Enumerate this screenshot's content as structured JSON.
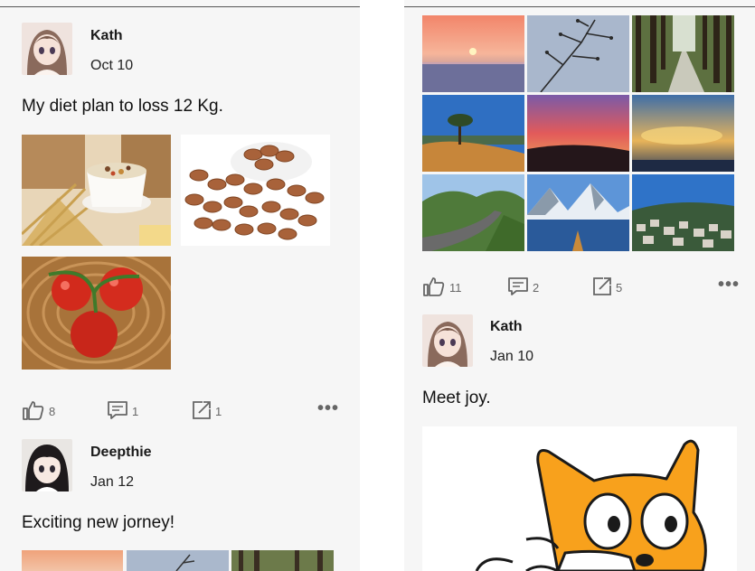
{
  "left_screen": {
    "post1": {
      "author": "Kath",
      "date": "Oct 10",
      "text": "My diet plan to loss 12 Kg.",
      "likes": "8",
      "comments": "1",
      "shares": "1"
    },
    "post2": {
      "author": "Deepthie",
      "date": "Jan 12",
      "text": "Exciting new jorney!"
    }
  },
  "right_screen": {
    "post1": {
      "likes": "11",
      "comments": "2",
      "shares": "5"
    },
    "post2": {
      "author": "Kath",
      "date": "Jan 10",
      "text": "Meet joy."
    }
  },
  "icons": {
    "like": "thumbs-up-icon",
    "comment": "comment-icon",
    "share": "share-icon",
    "more": "more-icon"
  }
}
